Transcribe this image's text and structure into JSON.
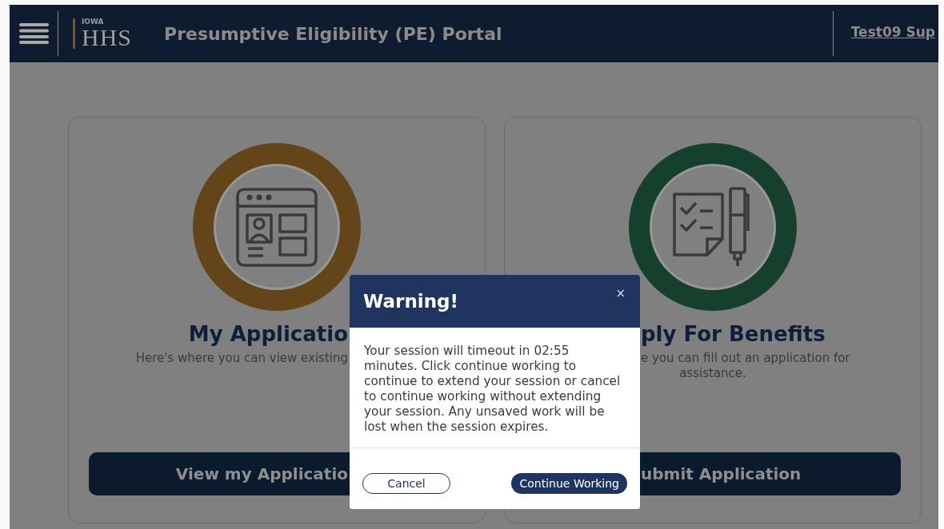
{
  "header": {
    "logo": {
      "small": "IOWA",
      "main": "HHS"
    },
    "title": "Presumptive Eligibility (PE) Portal",
    "user_link": "Test09 Sup"
  },
  "cards": [
    {
      "kind": "profile-window",
      "color": "#634519",
      "title": {
        "text": "My Applicatio",
        "covered": true
      },
      "description": [
        {
          "text": "Here's where you can view existing",
          "covered": true
        }
      ],
      "button": {
        "text": "View my Applicatio",
        "covered": true
      }
    },
    {
      "kind": "checklist-pen",
      "color": "#16402e",
      "title": {
        "text": "ply For Benefits",
        "covered": true
      },
      "description": [
        {
          "text": "e you can fill out an application for",
          "covered": true
        },
        {
          "text": "assistance.",
          "covered": false
        }
      ],
      "button": {
        "text": "ubmit Application",
        "covered": true
      }
    }
  ],
  "dialog": {
    "title": "Warning!",
    "close": "×",
    "message": "Your session will timeout in 02:55 minutes. Click continue working to continue to extend your session or cancel to continue working without extending your session. Any unsaved work will be lost when the session expires.",
    "buttons": [
      {
        "kind": "secondary",
        "label": "Cancel"
      },
      {
        "kind": "primary",
        "label": "Continue Working"
      }
    ]
  }
}
